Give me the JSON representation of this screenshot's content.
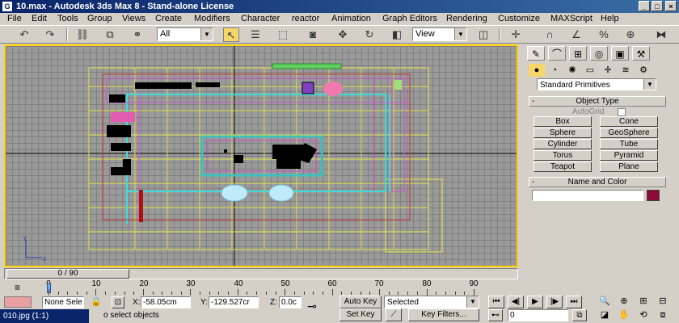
{
  "window": {
    "title": "10.max - Autodesk 3ds Max 8 - Stand-alone License",
    "app_icon": "G",
    "minimize": "_",
    "maximize": "□",
    "close": "×"
  },
  "menu": [
    "File",
    "Edit",
    "Tools",
    "Group",
    "Views",
    "Create",
    "Modifiers",
    "Character",
    "reactor",
    "Animation",
    "Graph Editors",
    "Rendering",
    "Customize",
    "MAXScript",
    "Help"
  ],
  "toolbar": {
    "selection_filter": "All",
    "reference_coord": "View",
    "icons": [
      "undo-icon",
      "redo-icon",
      "link-icon",
      "unlink-icon",
      "bind-space-warp-icon",
      "select-object-icon",
      "select-by-name-icon",
      "rectangle-region-icon",
      "window-crossing-icon",
      "move-icon",
      "rotate-icon",
      "scale-icon",
      "use-pivot-icon",
      "mirror-icon",
      "align-icon",
      "snap-icon",
      "angle-snap-icon",
      "percent-snap-icon",
      "spinner-snap-icon"
    ]
  },
  "command_panel": {
    "category_dropdown": "Standard Primitives",
    "object_type_header": "Object Type",
    "autogrid_label": "AutoGrid",
    "primitives": [
      "Box",
      "Cone",
      "Sphere",
      "GeoSphere",
      "Cylinder",
      "Tube",
      "Torus",
      "Pyramid",
      "Teapot",
      "Plane"
    ],
    "name_color_header": "Name and Color",
    "object_name": "",
    "object_color": "#8b0a3a"
  },
  "timeline": {
    "frame_display": "0 / 90",
    "current_frame": 0,
    "total_frames": 90,
    "tick_labels": [
      "0",
      "10",
      "20",
      "30",
      "40",
      "50",
      "60",
      "70",
      "80",
      "90"
    ]
  },
  "status": {
    "selection": "None Sele",
    "x_label": "X:",
    "x_value": "-58.05cm",
    "y_label": "Y:",
    "y_value": "-129.527cr",
    "z_label": "Z:",
    "z_value": "0.0c",
    "prompt": "o select objects",
    "auto_key": "Auto Key",
    "set_key": "Set Key",
    "key_mode": "Selected",
    "key_filters": "Key Filters...",
    "frame_field": "0"
  },
  "taskbar": {
    "item": "010.jpg (1:1)"
  },
  "colors": {
    "viewport_border": "#ffd200",
    "active_tool": "#f5d76b",
    "title_bar": "#0a246a"
  }
}
